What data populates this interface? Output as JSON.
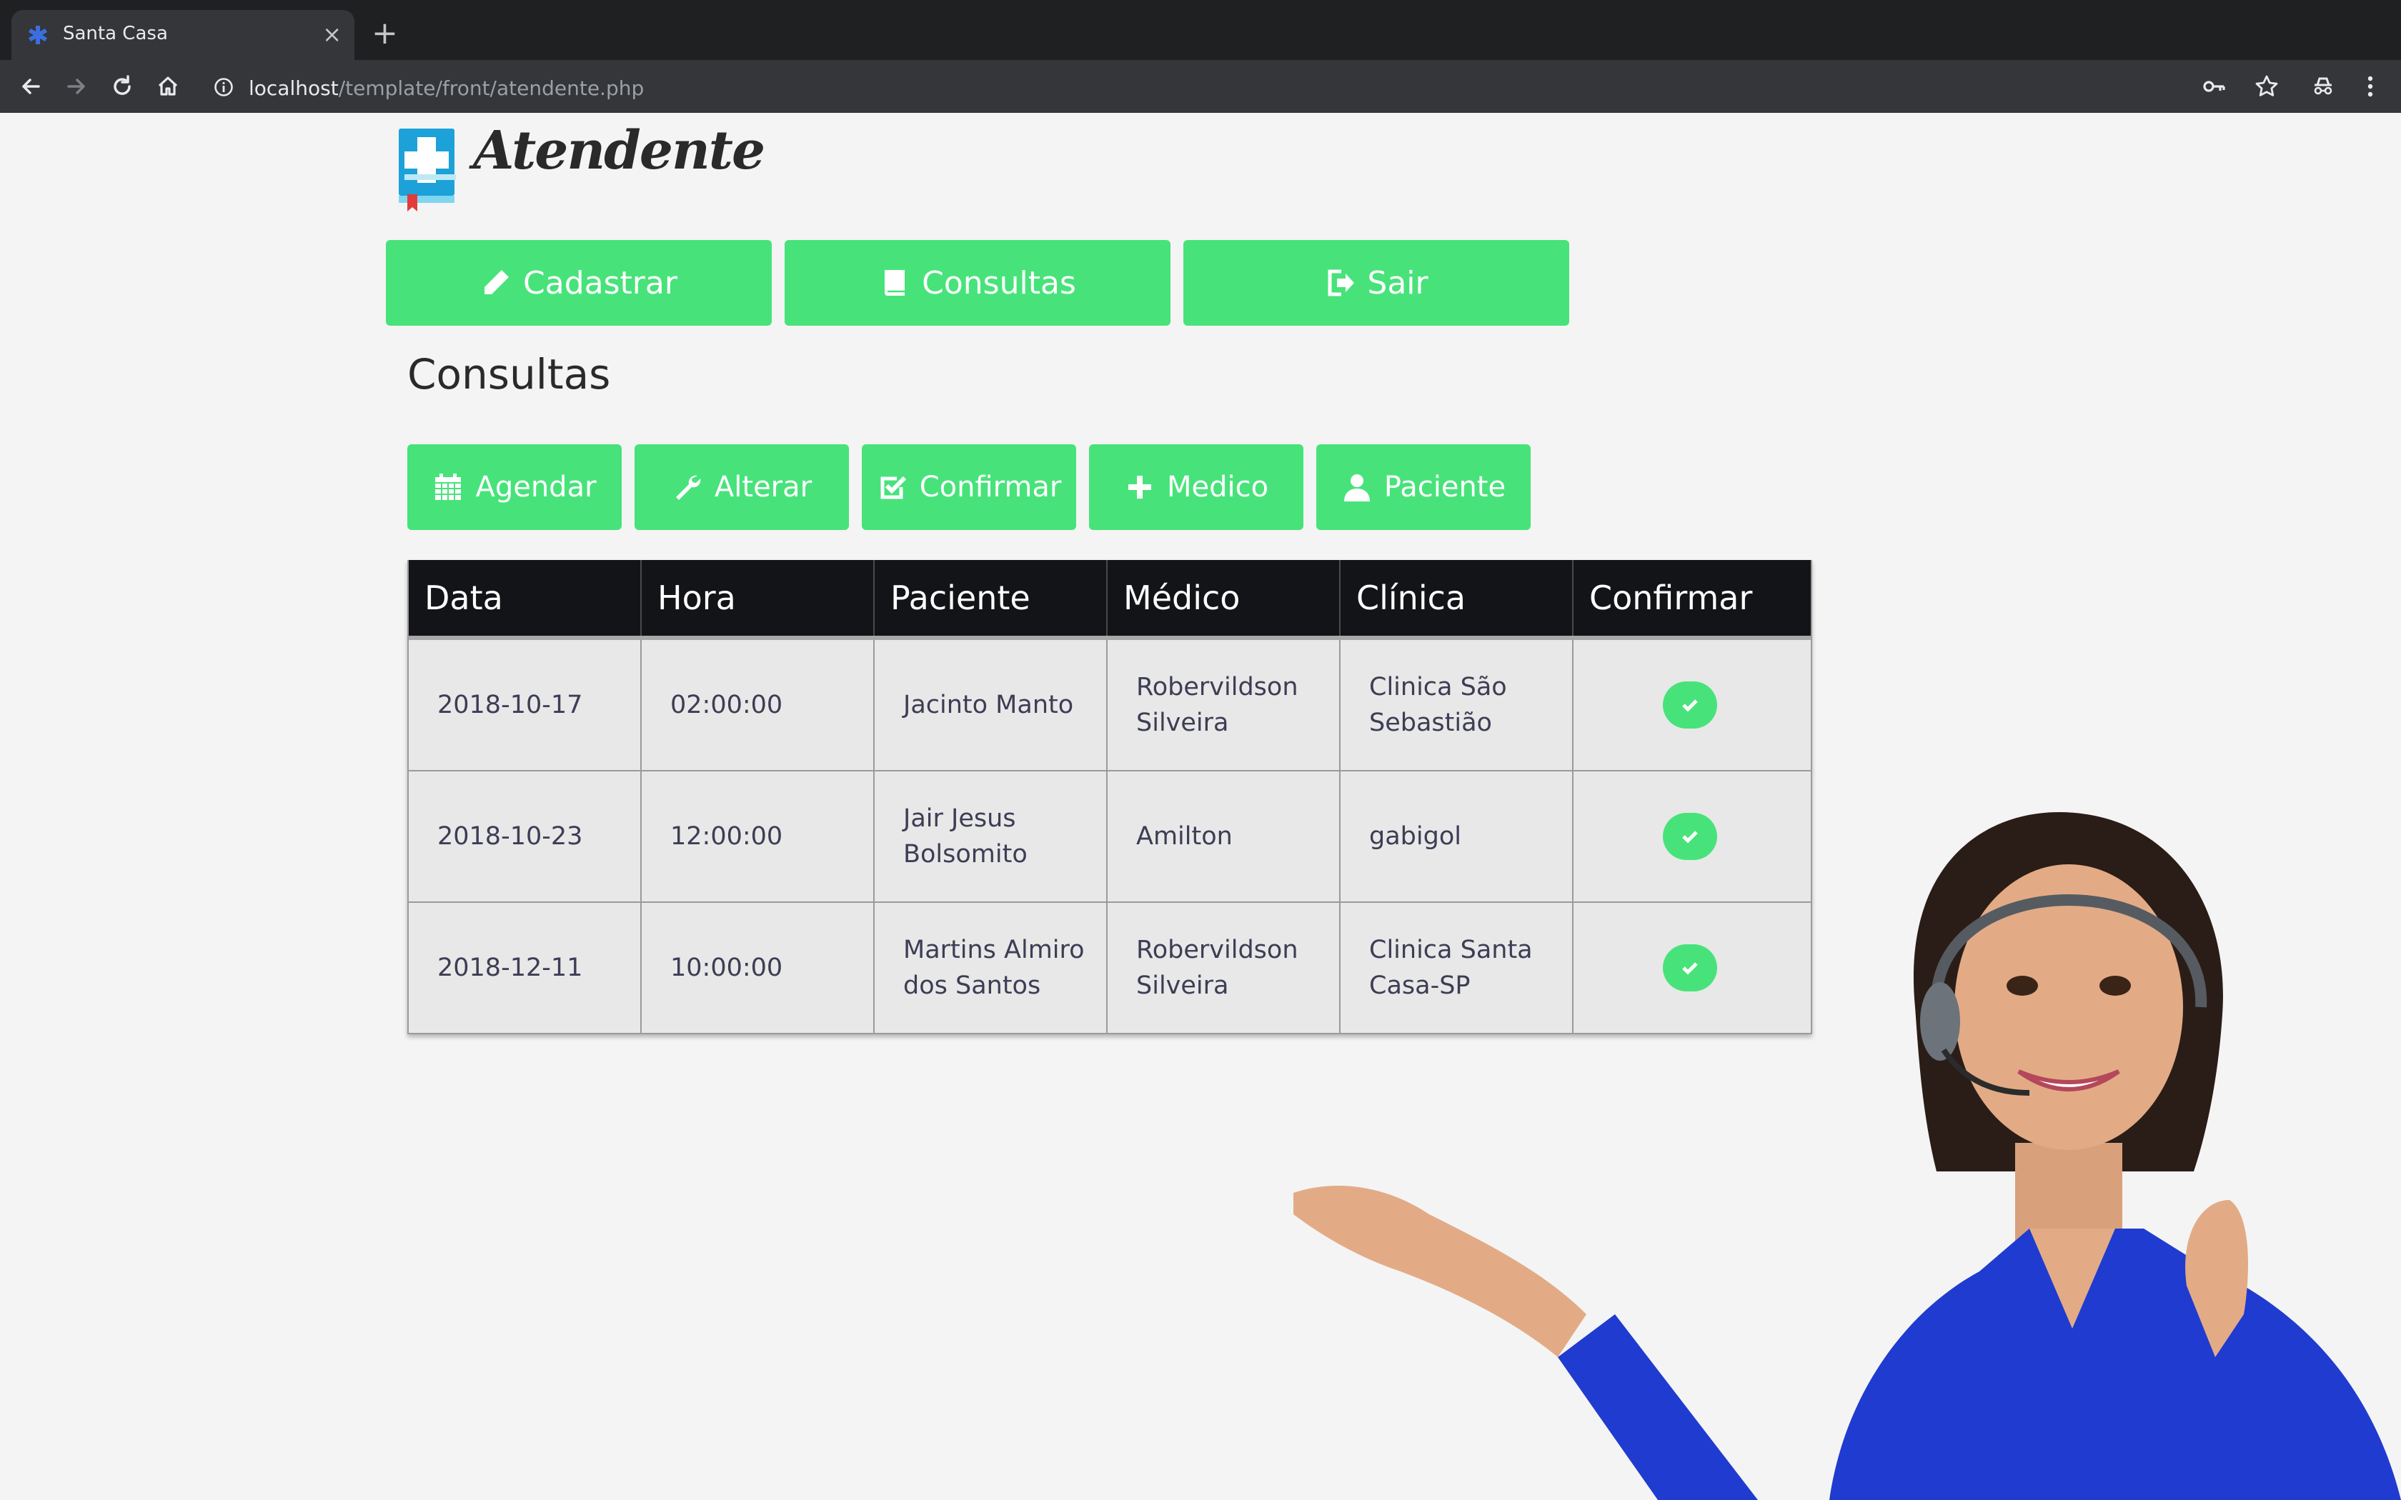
{
  "browser": {
    "tab_title": "Santa Casa",
    "tab_close": "×",
    "new_tab": "+",
    "url_host": "localhost",
    "url_path": "/template/front/atendente.php"
  },
  "page": {
    "logo_text": "Atendente",
    "section_title": "Consultas"
  },
  "nav": [
    {
      "label": "Cadastrar",
      "icon": "pencil-icon"
    },
    {
      "label": "Consultas",
      "icon": "book-icon"
    },
    {
      "label": "Sair",
      "icon": "sign-out-icon"
    }
  ],
  "actions": [
    {
      "label": "Agendar",
      "icon": "calendar-icon"
    },
    {
      "label": "Alterar",
      "icon": "wrench-icon"
    },
    {
      "label": "Confirmar",
      "icon": "check-square-icon"
    },
    {
      "label": "Medico",
      "icon": "plus-icon"
    },
    {
      "label": "Paciente",
      "icon": "user-icon"
    }
  ],
  "table": {
    "headers": [
      "Data",
      "Hora",
      "Paciente",
      "Médico",
      "Clínica",
      "Confirmar"
    ],
    "rows": [
      [
        "2018-10-17",
        "02:00:00",
        "Jacinto Manto",
        "Robervildson Silveira",
        "Clinica São Sebastião"
      ],
      [
        "2018-10-23",
        "12:00:00",
        "Jair Jesus Bolsomito",
        "Amilton",
        "gabigol"
      ],
      [
        "2018-12-11",
        "10:00:00",
        "Martins Almiro dos Santos",
        "Robervildson Silveira",
        "Clinica Santa Casa-SP"
      ]
    ]
  },
  "colors": {
    "accent_green": "#47e37a",
    "table_header": "#131417",
    "page_bg": "#f4f4f4",
    "chrome_dark": "#1f2022",
    "chrome_toolbar": "#35363a"
  }
}
